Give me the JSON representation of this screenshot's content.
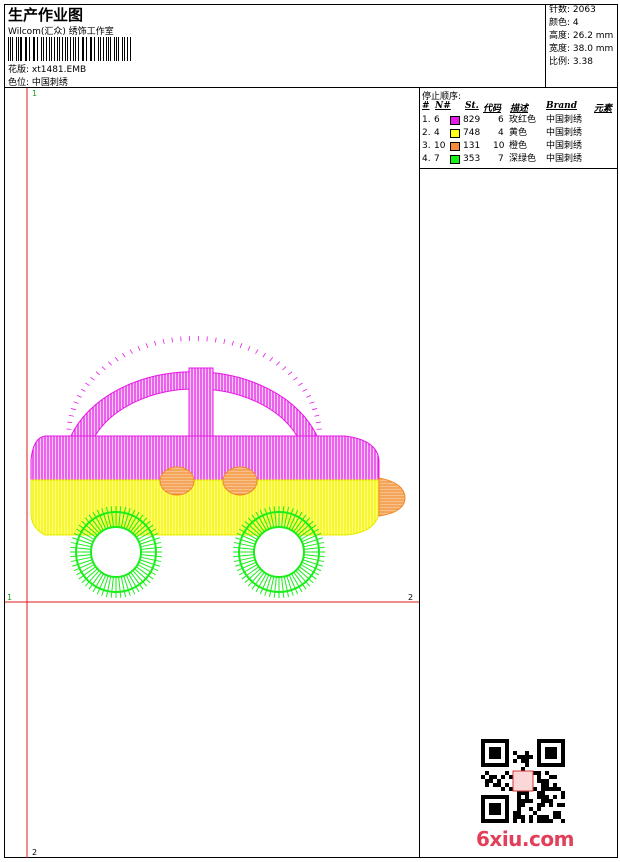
{
  "header": {
    "title": "生产作业图",
    "company": "Wilcom(汇众) 绣饰工作室",
    "pattern_line": "花版: xt1481.EMB",
    "color_line": "色位: 中国刺绣"
  },
  "stats": {
    "stitches": "针数: 2063",
    "colors": "颜色: 4",
    "height": "高度: 26.2 mm",
    "width": "宽度: 38.0 mm",
    "ratio": "比例: 3.38"
  },
  "stop_sequence": {
    "title": "停止顺序:",
    "headers": {
      "hash": "#",
      "no": "N#",
      "st": "St.",
      "code": "代码",
      "desc": "描述",
      "brand": "Brand",
      "element": "元素"
    },
    "rows": [
      {
        "idx": "1.",
        "no": "6",
        "color": "#e619e6",
        "st": "829",
        "code": "6",
        "desc": "玫红色",
        "brand": "中国刺绣"
      },
      {
        "idx": "2.",
        "no": "4",
        "color": "#ffff1a",
        "st": "748",
        "code": "4",
        "desc": "黄色",
        "brand": "中国刺绣"
      },
      {
        "idx": "3.",
        "no": "10",
        "color": "#f58c3c",
        "st": "131",
        "code": "10",
        "desc": "橙色",
        "brand": "中国刺绣"
      },
      {
        "idx": "4.",
        "no": "7",
        "color": "#1aee1a",
        "st": "353",
        "code": "7",
        "desc": "深绿色",
        "brand": "中国刺绣"
      }
    ]
  },
  "guides": {
    "marker_1": "1",
    "marker_2": "2"
  },
  "watermark": "6xiu.com"
}
